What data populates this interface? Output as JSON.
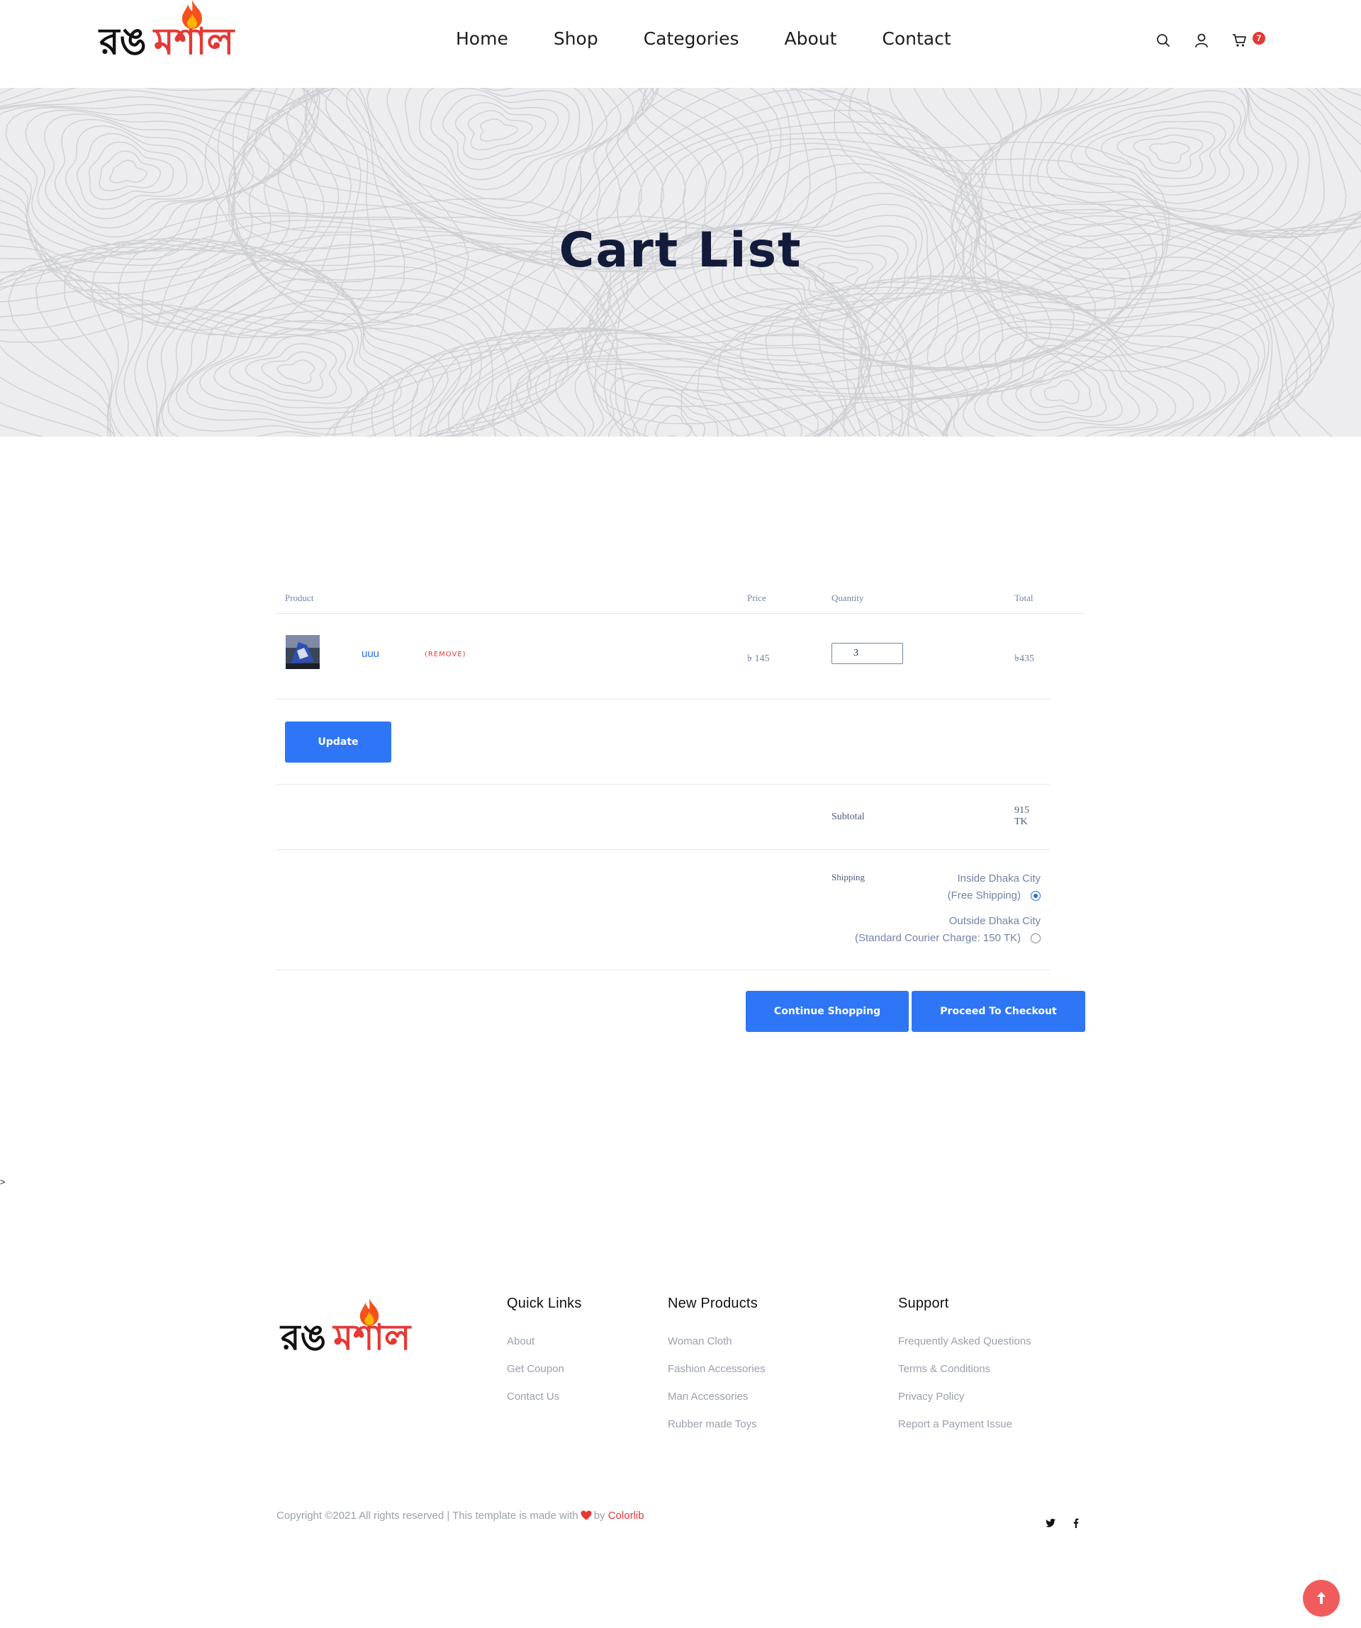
{
  "brand": {
    "word1": "রঙ",
    "word2": "মশাল"
  },
  "nav": {
    "items": [
      "Home",
      "Shop",
      "Categories",
      "About",
      "Contact"
    ]
  },
  "header_icons": {
    "search": "search-icon",
    "account": "user-icon",
    "cart": "cart-icon",
    "cart_count": "7"
  },
  "hero": {
    "title": "Cart List"
  },
  "cart": {
    "headers": {
      "product": "Product",
      "price": "Price",
      "quantity": "Quantity",
      "total": "Total"
    },
    "item": {
      "name": "uuu",
      "remove_label": "(REMOVE)",
      "price": "৳ 145",
      "quantity": "3",
      "total": "৳435"
    },
    "update_label": "Update",
    "subtotal_label": "Subtotal",
    "subtotal_value": "915 TK",
    "shipping_label": "Shipping",
    "shipping_options": [
      {
        "line1": "Inside Dhaka City",
        "line2": "(Free Shipping)",
        "selected": true
      },
      {
        "line1": "Outside Dhaka City",
        "line2": "(Standard Courier Charge: 150 TK)",
        "selected": false
      }
    ],
    "continue_label": "Continue Shopping",
    "checkout_label": "Proceed To Checkout"
  },
  "stray_text": ">",
  "footer": {
    "quick_links": {
      "title": "Quick Links",
      "items": [
        "About",
        "Get Coupon",
        "Contact Us"
      ]
    },
    "new_products": {
      "title": "New Products",
      "items": [
        "Woman Cloth",
        "Fashion Accessories",
        "Man Accessories",
        "Rubber made Toys"
      ]
    },
    "support": {
      "title": "Support",
      "items": [
        "Frequently Asked Questions",
        "Terms & Conditions",
        "Privacy Policy",
        "Report a Payment Issue"
      ]
    },
    "copyright_pre": "Copyright ©2021 All rights reserved | This template is made with",
    "copyright_by": "by",
    "copyright_brand": "Colorlib",
    "social": [
      "twitter-icon",
      "facebook-icon"
    ]
  },
  "colors": {
    "accent": "#2f76f6",
    "brand_red": "#e53935",
    "heading": "#131b3a",
    "muted": "#7383a7"
  }
}
